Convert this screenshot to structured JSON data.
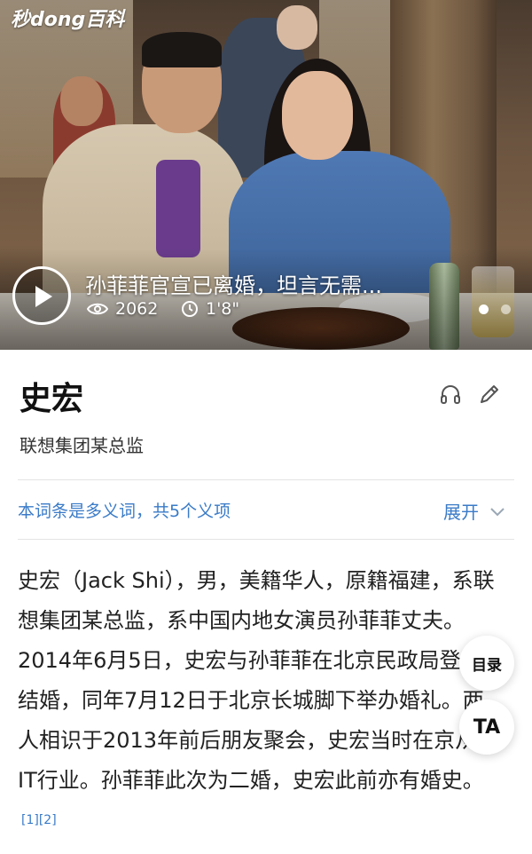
{
  "brand": {
    "logo_text": "秒dong百科"
  },
  "video": {
    "title": "孙菲菲官宣已离婚，坦言无需...",
    "views": "2062",
    "duration": "1'8\"",
    "icons": [
      "play-icon",
      "eye-icon",
      "clock-icon"
    ],
    "carousel_pages": 2,
    "carousel_active": 1
  },
  "entry": {
    "title": "史宏",
    "subtitle": "联想集团某总监",
    "tools": [
      "headphones-icon",
      "pencil-icon"
    ]
  },
  "polysemy": {
    "text": "本词条是多义词，共5个义项",
    "expand_label": "展开"
  },
  "summary": {
    "text": "史宏（Jack Shi），男，美籍华人，原籍福建，系联想集团某总监，系中国内地女演员孙菲菲丈夫。2014年6月5日，史宏与孙菲菲在北京民政局登记结婚，同年7月12日于北京长城脚下举办婚礼。两人相识于2013年前后朋友聚会，史宏当时在京从事IT行业。孙菲菲此次为二婚，史宏此前亦有婚史。",
    "citation": "[1][2]"
  },
  "floating": {
    "toc_label": "目录",
    "font_label": "TA"
  },
  "colors": {
    "link_blue": "#3a7bc8",
    "text_dark": "#222222",
    "divider": "#e4e4e4"
  }
}
